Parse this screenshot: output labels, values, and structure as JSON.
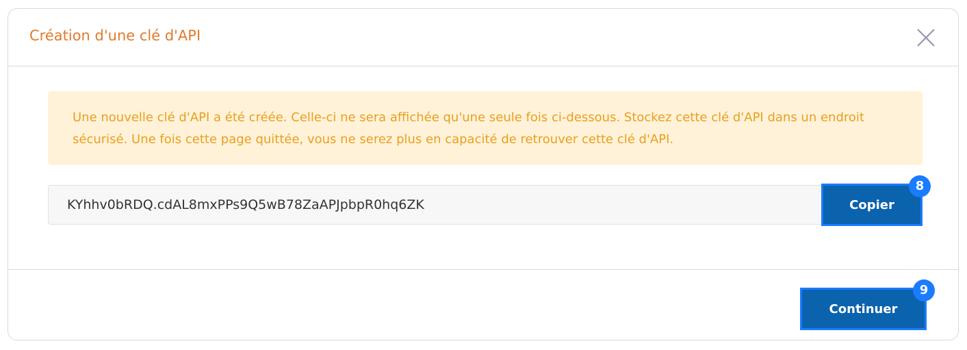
{
  "modal": {
    "title": "Création d'une clé d'API",
    "close_icon": "close-icon"
  },
  "alert": {
    "message": "Une nouvelle clé d'API a été créée. Celle-ci ne sera affichée qu'une seule fois ci-dessous. Stockez cette clé d'API dans un endroit sécurisé. Une fois cette page quittée, vous ne serez plus en capacité de retrouver cette clé d'API."
  },
  "api_key": {
    "value": "KYhhv0bRDQ.cdAL8mxPPs9Q5wB78ZaAPJpbpR0hq6ZK"
  },
  "buttons": {
    "copy_label": "Copier",
    "copy_badge": "8",
    "continue_label": "Continuer",
    "continue_badge": "9"
  },
  "colors": {
    "title": "#e07b2c",
    "alert_bg": "#fff2d9",
    "alert_text": "#e8a01e",
    "button_bg": "#0b62ad",
    "highlight": "#1a7cff"
  }
}
